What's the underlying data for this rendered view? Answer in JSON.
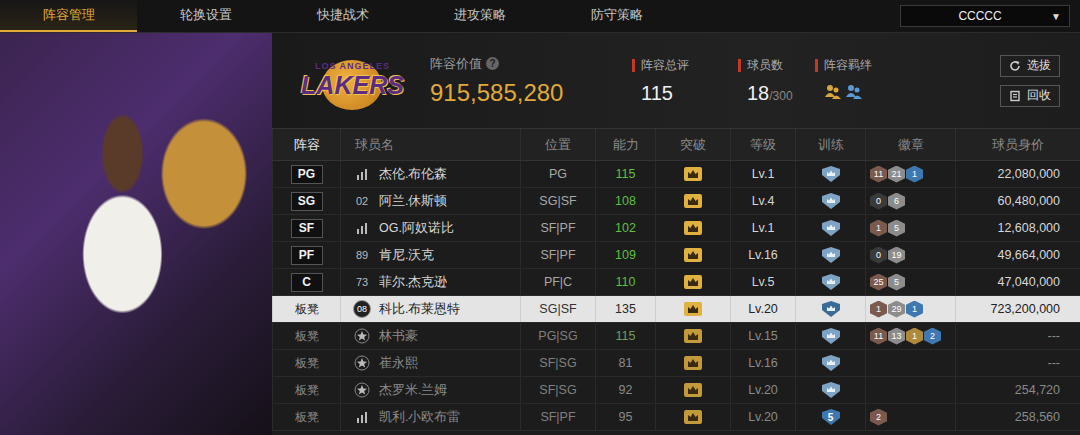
{
  "tabs": [
    {
      "label": "阵容管理",
      "selected": true
    },
    {
      "label": "轮换设置",
      "selected": false
    },
    {
      "label": "快捷战术",
      "selected": false
    },
    {
      "label": "进攻策略",
      "selected": false
    },
    {
      "label": "防守策略",
      "selected": false
    }
  ],
  "team_select": {
    "value": "CCCCC",
    "arrow": "▼"
  },
  "logo": {
    "top": "LOS ANGELES",
    "main": "LAKERS"
  },
  "value": {
    "label": "阵容价值",
    "help": "?",
    "amount": "915,585,280"
  },
  "stats": [
    {
      "kind": "number",
      "label": "阵容总评",
      "value": "115",
      "suffix": "",
      "icons": []
    },
    {
      "kind": "number",
      "label": "球员数",
      "value": "18",
      "suffix": "/300",
      "icons": []
    },
    {
      "kind": "bonds",
      "label": "阵容羁绊",
      "value": "",
      "suffix": "",
      "icons": [
        {
          "color": "#d9a63a"
        },
        {
          "color": "#5b9bd5"
        }
      ]
    }
  ],
  "actions": [
    {
      "label": "选拔",
      "kind": "refresh"
    },
    {
      "label": "回收",
      "kind": "recycle"
    }
  ],
  "table": {
    "columns": [
      {
        "label": "阵容",
        "selected": true
      },
      {
        "label": "球员名",
        "selected": false
      },
      {
        "label": "位置",
        "selected": false
      },
      {
        "label": "能力",
        "selected": false
      },
      {
        "label": "突破",
        "selected": false
      },
      {
        "label": "等级",
        "selected": false
      },
      {
        "label": "训练",
        "selected": false
      },
      {
        "label": "徽章",
        "selected": false
      },
      {
        "label": "球员身价",
        "selected": false
      }
    ],
    "rows": [
      {
        "slot": "PG",
        "starter": true,
        "name_icon": {
          "kind": "bars",
          "text": ""
        },
        "name": "杰伦.布伦森",
        "position": "PG",
        "ability": "115",
        "ability_color": "#5fbf3f",
        "level": "Lv.1",
        "training": "",
        "badges": [
          {
            "count": "11",
            "color": "#7b5a4d"
          },
          {
            "count": "21",
            "color": "#8c8c8c"
          },
          {
            "count": "1",
            "color": "#3f78b0"
          }
        ],
        "price": "22,080,000",
        "selected": false,
        "dimmed": false
      },
      {
        "slot": "SG",
        "starter": true,
        "name_icon": {
          "kind": "number",
          "text": "02"
        },
        "name": "阿兰.休斯顿",
        "position": "SG|SF",
        "ability": "108",
        "ability_color": "#5fbf3f",
        "level": "Lv.4",
        "training": "",
        "badges": [
          {
            "count": "0",
            "color": "#3a3a3a"
          },
          {
            "count": "6",
            "color": "#8c8c8c"
          }
        ],
        "price": "60,480,000",
        "selected": false,
        "dimmed": false
      },
      {
        "slot": "SF",
        "starter": true,
        "name_icon": {
          "kind": "bars",
          "text": ""
        },
        "name": "OG.阿奴诺比",
        "position": "SF|PF",
        "ability": "102",
        "ability_color": "#5fbf3f",
        "level": "Lv.1",
        "training": "",
        "badges": [
          {
            "count": "1",
            "color": "#7b5a4d"
          },
          {
            "count": "5",
            "color": "#8c8c8c"
          }
        ],
        "price": "12,608,000",
        "selected": false,
        "dimmed": false
      },
      {
        "slot": "PF",
        "starter": true,
        "name_icon": {
          "kind": "number",
          "text": "89"
        },
        "name": "肯尼.沃克",
        "position": "SF|PF",
        "ability": "109",
        "ability_color": "#5fbf3f",
        "level": "Lv.16",
        "training": "",
        "badges": [
          {
            "count": "0",
            "color": "#3a3a3a"
          },
          {
            "count": "19",
            "color": "#8c8c8c"
          }
        ],
        "price": "49,664,000",
        "selected": false,
        "dimmed": false
      },
      {
        "slot": "C",
        "starter": true,
        "name_icon": {
          "kind": "number",
          "text": "73"
        },
        "name": "菲尔.杰克逊",
        "position": "PF|C",
        "ability": "110",
        "ability_color": "#5fbf3f",
        "level": "Lv.5",
        "training": "",
        "badges": [
          {
            "count": "25",
            "color": "#7b5a4d"
          },
          {
            "count": "5",
            "color": "#8c8c8c"
          }
        ],
        "price": "47,040,000",
        "selected": false,
        "dimmed": false
      },
      {
        "slot": "板凳",
        "starter": false,
        "name_icon": {
          "kind": "circle-number",
          "text": "08"
        },
        "name": "科比.布莱恩特",
        "position": "SG|SF",
        "ability": "135",
        "ability_color": "#2a2a2a",
        "level": "Lv.20",
        "training": "",
        "badges": [
          {
            "count": "1",
            "color": "#7b5a4d"
          },
          {
            "count": "29",
            "color": "#8c8c8c"
          },
          {
            "count": "1",
            "color": "#3f78b0"
          }
        ],
        "price": "723,200,000",
        "selected": true,
        "dimmed": false
      },
      {
        "slot": "板凳",
        "starter": false,
        "name_icon": {
          "kind": "star",
          "text": ""
        },
        "name": "林书豪",
        "position": "PG|SG",
        "ability": "115",
        "ability_color": "#6f9c5e",
        "level": "Lv.15",
        "training": "",
        "badges": [
          {
            "count": "11",
            "color": "#7b5a4d"
          },
          {
            "count": "13",
            "color": "#8c8c8c"
          },
          {
            "count": "1",
            "color": "#b08a3a"
          },
          {
            "count": "2",
            "color": "#3f78b0"
          }
        ],
        "price": "---",
        "selected": false,
        "dimmed": true
      },
      {
        "slot": "板凳",
        "starter": false,
        "name_icon": {
          "kind": "star",
          "text": ""
        },
        "name": "崔永熙",
        "position": "SF|SG",
        "ability": "81",
        "ability_color": "#8a8a8a",
        "level": "Lv.16",
        "training": "",
        "badges": [],
        "price": "---",
        "selected": false,
        "dimmed": true
      },
      {
        "slot": "板凳",
        "starter": false,
        "name_icon": {
          "kind": "star",
          "text": ""
        },
        "name": "杰罗米.兰姆",
        "position": "SF|SG",
        "ability": "92",
        "ability_color": "#8a8a8a",
        "level": "Lv.20",
        "training": "",
        "badges": [],
        "price": "254,720",
        "selected": false,
        "dimmed": true
      },
      {
        "slot": "板凳",
        "starter": false,
        "name_icon": {
          "kind": "bars",
          "text": ""
        },
        "name": "凯利.小欧布雷",
        "position": "SF|PF",
        "ability": "95",
        "ability_color": "#8a8a8a",
        "level": "Lv.20",
        "training": "5",
        "badges": [
          {
            "count": "2",
            "color": "#7b5a4d"
          }
        ],
        "price": "258,560",
        "selected": false,
        "dimmed": true
      }
    ]
  }
}
